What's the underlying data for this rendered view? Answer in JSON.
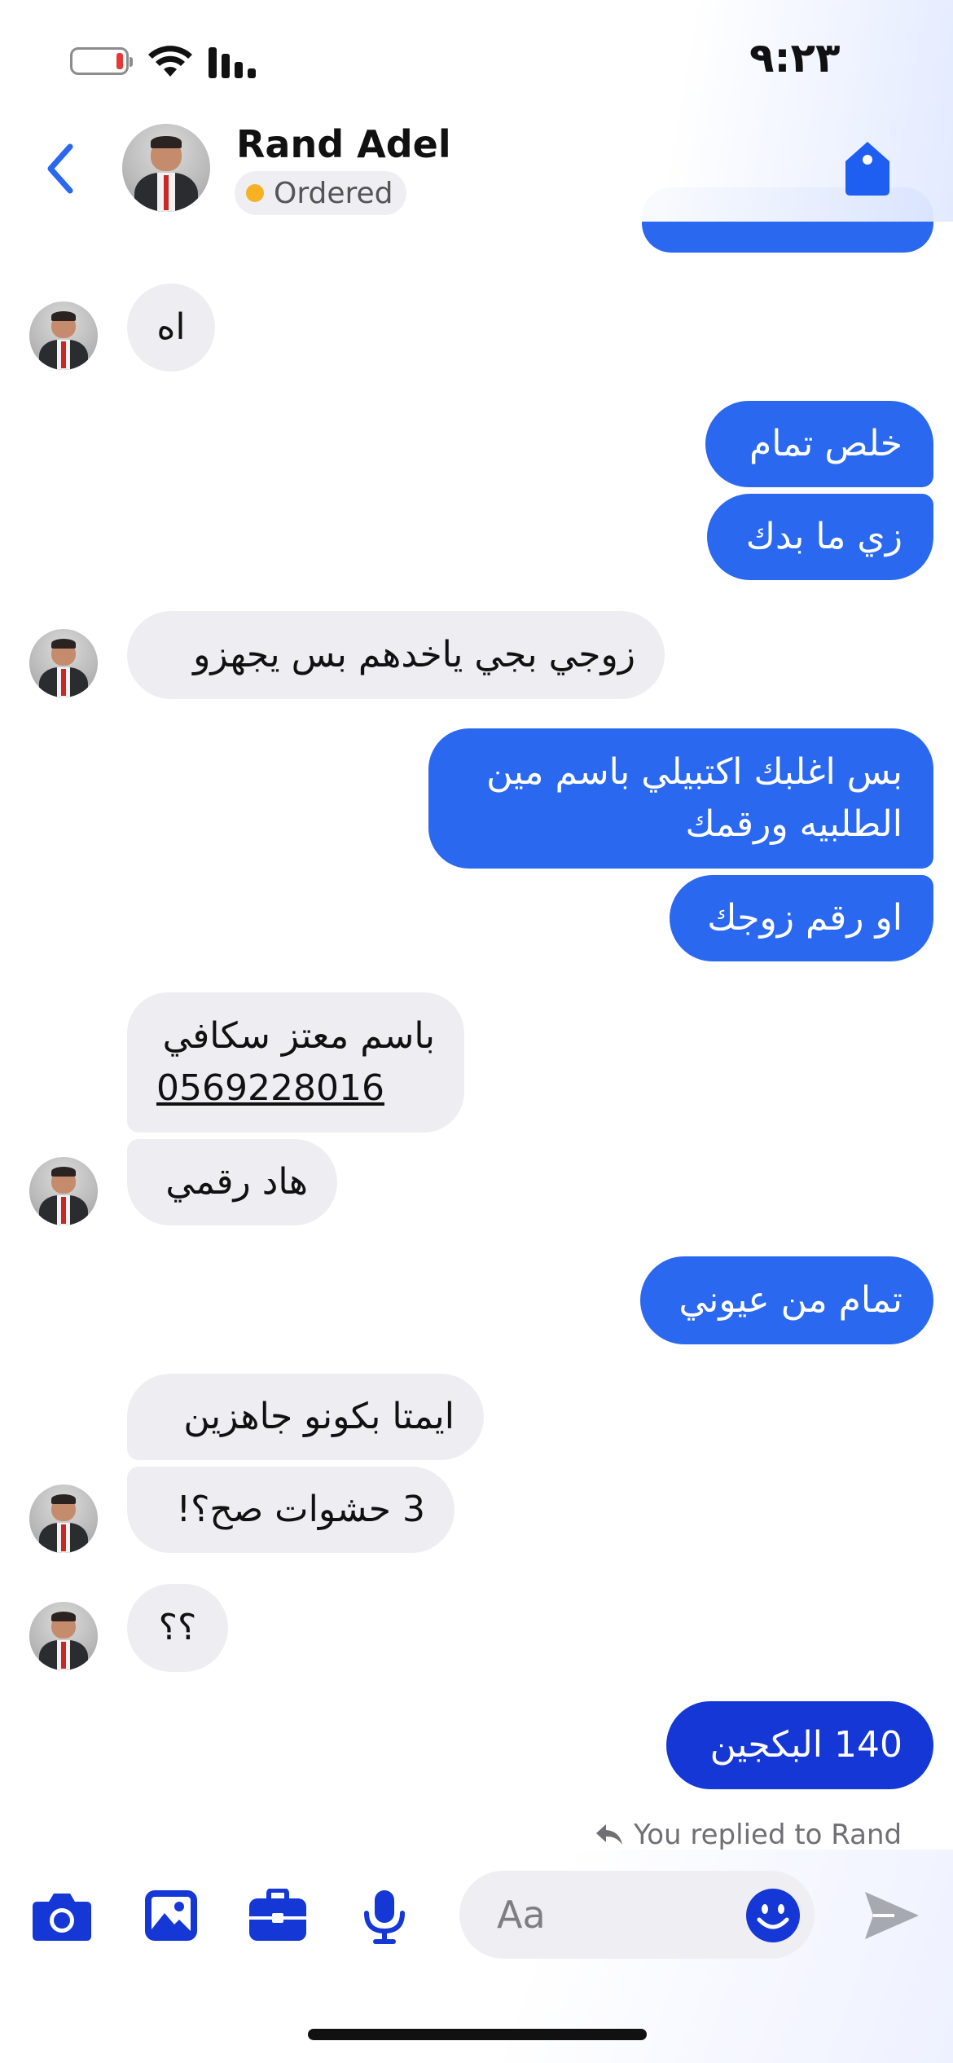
{
  "status_bar": {
    "time": "٩:٢٣"
  },
  "header": {
    "contact_name": "Rand Adel",
    "status_label": "Ordered",
    "status_color": "#f6b225",
    "back_icon": "chevron-left-icon",
    "tag_icon": "tag-icon"
  },
  "messages": [
    {
      "side": "recv",
      "text": "اه"
    },
    {
      "side": "sent",
      "text": "خلص تمام"
    },
    {
      "side": "sent",
      "text": "زي ما بدك"
    },
    {
      "side": "recv",
      "text": "زوجي بجي ياخدهم بس يجهزو"
    },
    {
      "side": "sent",
      "line1": "بس اغلبك اكتبيلي باسم مين",
      "line2": "الطلبيه ورقمك"
    },
    {
      "side": "sent",
      "text": "او رقم زوجك"
    },
    {
      "side": "recv",
      "line1": "باسم معتز سكافي",
      "phone": "0569228016"
    },
    {
      "side": "recv",
      "text": "هاد رقمي"
    },
    {
      "side": "sent",
      "text": "تمام من عيوني"
    },
    {
      "side": "recv",
      "text": "ايمتا بكونو جاهزين"
    },
    {
      "side": "recv",
      "text": "3 حشوات صح؟!"
    },
    {
      "side": "recv",
      "text": "؟؟"
    },
    {
      "side": "sent",
      "text": "140 البكجين"
    }
  ],
  "reply_note": "You replied to Rand",
  "composer": {
    "placeholder": "Aa",
    "tools": [
      "camera-icon",
      "image-icon",
      "briefcase-icon",
      "microphone-icon"
    ],
    "emoji_icon": "smiley-icon",
    "send_icon": "send-icon"
  },
  "colors": {
    "sent_bubble": "#2b68f0",
    "sent_bubble_latest": "#1437d6",
    "received_bubble": "#eeeef2",
    "accent": "#1437d6"
  }
}
